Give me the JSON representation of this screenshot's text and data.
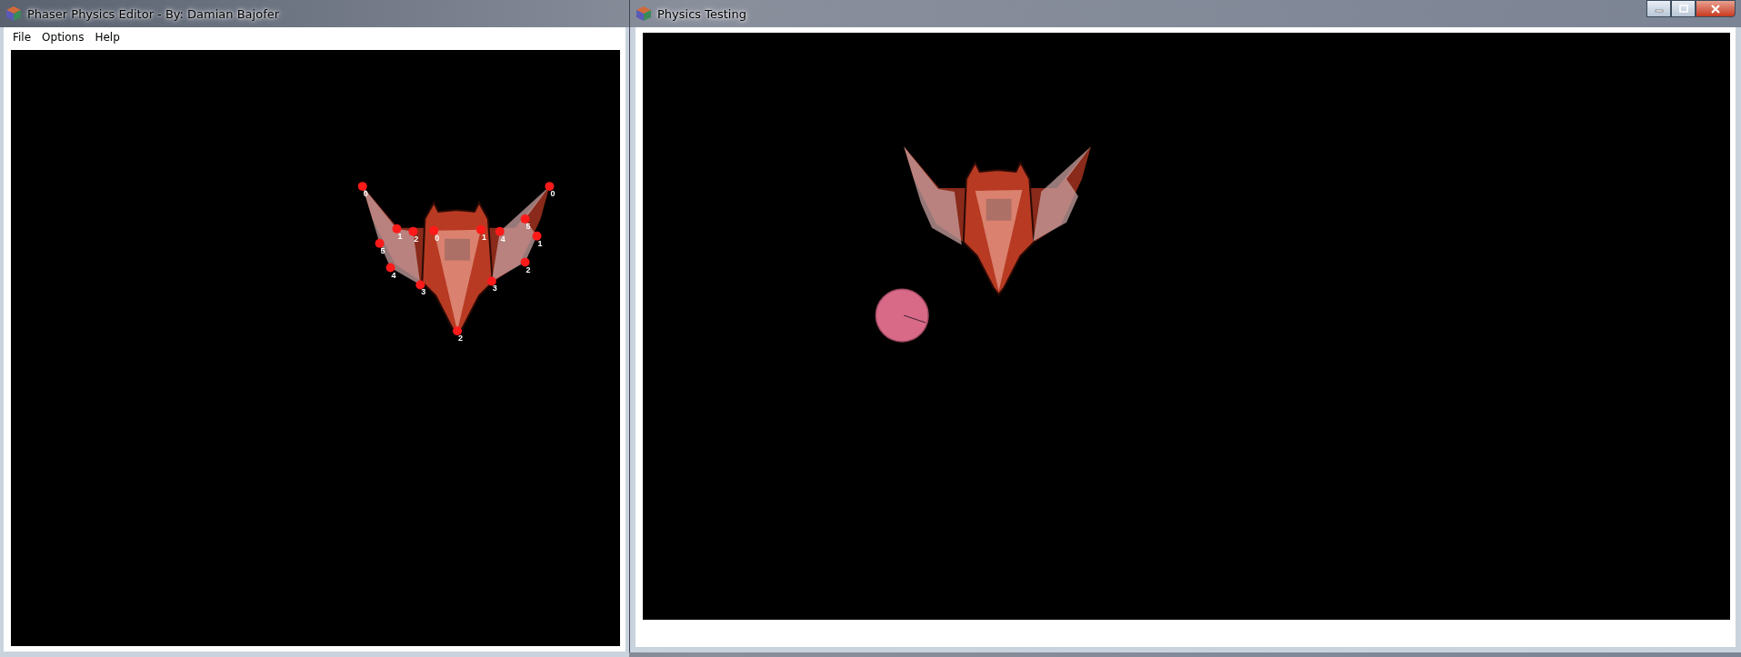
{
  "editor_window": {
    "title": "Phaser Physics Editor - By: Damian Bajofer",
    "menu": [
      {
        "label": "File"
      },
      {
        "label": "Options"
      },
      {
        "label": "Help"
      }
    ],
    "shapes": [
      {
        "vertices": [
          "0",
          "1",
          "2",
          "3",
          "4",
          "5"
        ]
      },
      {
        "vertices": [
          "0",
          "1",
          "2"
        ]
      },
      {
        "vertices": [
          "0",
          "5",
          "1",
          "2",
          "3",
          "4"
        ]
      }
    ]
  },
  "test_window": {
    "title": "Physics Testing"
  }
}
